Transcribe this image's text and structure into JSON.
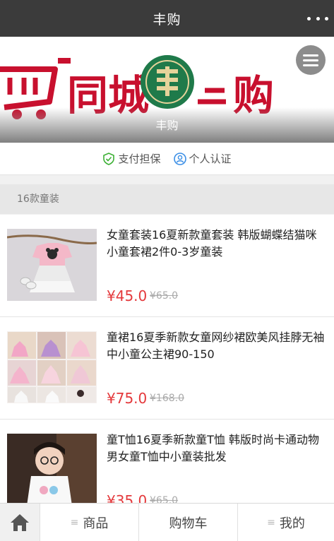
{
  "header": {
    "title": "丰购"
  },
  "banner": {
    "shop_name": "丰购",
    "brand_left": "同城",
    "brand_right": "购"
  },
  "guarantee": {
    "payment": "支付担保",
    "personal": "个人认证"
  },
  "section": {
    "title": "16款童装"
  },
  "products": [
    {
      "name": "女童套装16夏新款童套装 韩版蝴蝶结猫咪小童套裙2件0-3岁童装",
      "price": "¥45.0",
      "old_price": "¥65.0"
    },
    {
      "name": "童裙16夏季新款女童网纱裙欧美风挂脖无袖中小童公主裙90-150",
      "price": "¥75.0",
      "old_price": "¥168.0"
    },
    {
      "name": "童T恤16夏季新款童T恤 韩版时尚卡通动物男女童T恤中小童装批发",
      "price": "¥35.0",
      "old_price": "¥65.0"
    }
  ],
  "bottom_nav": {
    "products": "商品",
    "cart": "购物车",
    "mine": "我的"
  },
  "colors": {
    "topbar": "#3b3b3b",
    "price": "#e4393c",
    "banner_red": "#c8102e",
    "logo_green": "#1f7a4a"
  }
}
